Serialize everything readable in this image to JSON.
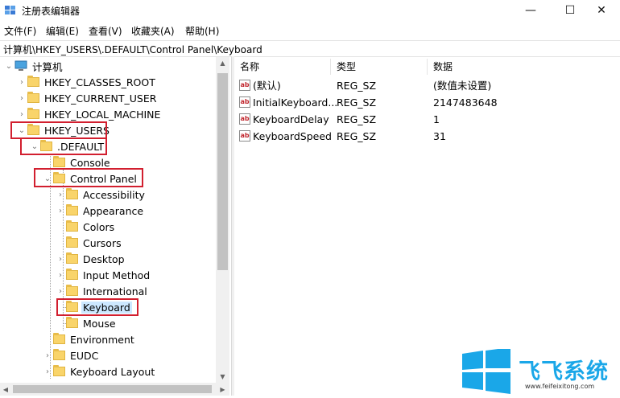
{
  "window": {
    "title": "注册表编辑器",
    "controls": {
      "minimize": "—",
      "maximize": "☐",
      "close": "✕"
    }
  },
  "menu": [
    "文件(F)",
    "编辑(E)",
    "查看(V)",
    "收藏夹(A)",
    "帮助(H)"
  ],
  "address": "计算机\\HKEY_USERS\\.DEFAULT\\Control Panel\\Keyboard",
  "tree": {
    "root": "计算机",
    "hives": [
      "HKEY_CLASSES_ROOT",
      "HKEY_CURRENT_USER",
      "HKEY_LOCAL_MACHINE",
      "HKEY_USERS"
    ],
    "default_key": ".DEFAULT",
    "default_children": [
      "Console",
      "Control Panel"
    ],
    "control_panel_children": [
      "Accessibility",
      "Appearance",
      "Colors",
      "Cursors",
      "Desktop",
      "Input Method",
      "International",
      "Keyboard",
      "Mouse"
    ],
    "more_default_children": [
      "Environment",
      "EUDC",
      "Keyboard Layout"
    ],
    "selected": "Keyboard"
  },
  "list": {
    "columns": [
      "名称",
      "类型",
      "数据"
    ],
    "rows": [
      {
        "name": "(默认)",
        "type": "REG_SZ",
        "data": "(数值未设置)"
      },
      {
        "name": "InitialKeyboard...",
        "type": "REG_SZ",
        "data": "2147483648"
      },
      {
        "name": "KeyboardDelay",
        "type": "REG_SZ",
        "data": "1"
      },
      {
        "name": "KeyboardSpeed",
        "type": "REG_SZ",
        "data": "31"
      }
    ],
    "value_icon_text": "ab"
  },
  "watermark": {
    "title": "飞飞系统",
    "url": "www.feifeixitong.com"
  },
  "colors": {
    "highlight_box": "#d21f2f",
    "selection": "#cce8ff",
    "win_logo": "#1aa7e8"
  }
}
